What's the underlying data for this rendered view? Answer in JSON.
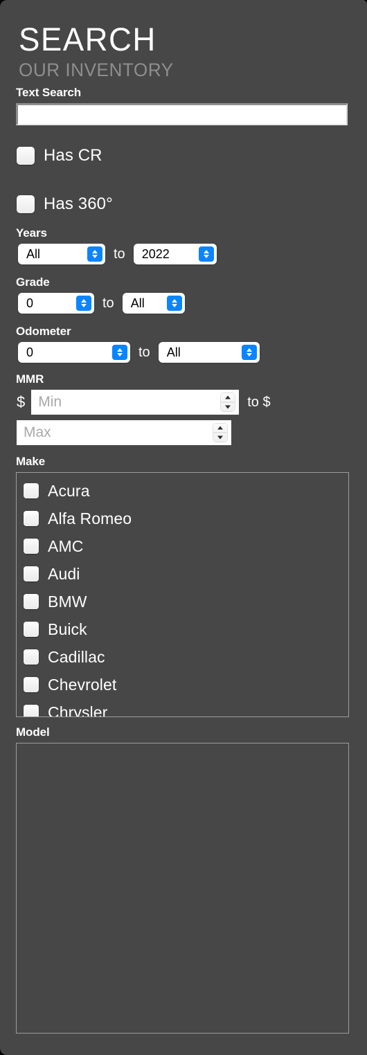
{
  "panel": {
    "title": "SEARCH",
    "subtitle": "OUR INVENTORY",
    "background_color": "#474747",
    "accent_color": "#0a84ff"
  },
  "text_search": {
    "label": "Text Search",
    "value": "",
    "placeholder": ""
  },
  "toggles": [
    {
      "label": "Has CR",
      "checked": false
    },
    {
      "label": "Has 360°",
      "checked": false
    }
  ],
  "years": {
    "label": "Years",
    "from_value": "All",
    "to_label": "to",
    "to_value": "2022"
  },
  "grade": {
    "label": "Grade",
    "from_value": "0",
    "to_label": "to",
    "to_value": "All"
  },
  "odometer": {
    "label": "Odometer",
    "from_value": "0",
    "to_label": "to",
    "to_value": "All"
  },
  "mmr": {
    "label": "MMR",
    "currency_symbol": "$",
    "min_value": "",
    "min_placeholder": "Min",
    "to_label": "to $",
    "max_value": "",
    "max_placeholder": "Max"
  },
  "make": {
    "label": "Make",
    "items": [
      {
        "label": "Acura",
        "checked": false
      },
      {
        "label": "Alfa Romeo",
        "checked": false
      },
      {
        "label": "AMC",
        "checked": false
      },
      {
        "label": "Audi",
        "checked": false
      },
      {
        "label": "BMW",
        "checked": false
      },
      {
        "label": "Buick",
        "checked": false
      },
      {
        "label": "Cadillac",
        "checked": false
      },
      {
        "label": "Chevrolet",
        "checked": false
      },
      {
        "label": "Chrysler",
        "checked": false
      }
    ]
  },
  "model": {
    "label": "Model",
    "items": []
  }
}
